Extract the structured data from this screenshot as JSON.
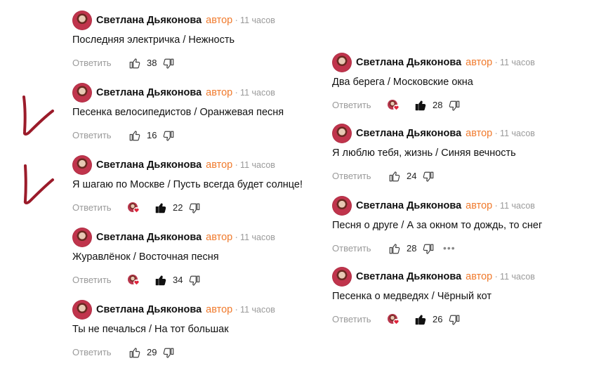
{
  "strings": {
    "author": "Светлана Дьяконова",
    "badge": "автор",
    "dot": "·",
    "time": "11 часов",
    "reply": "Ответить",
    "more": "•••"
  },
  "comments": [
    {
      "text": "Последняя электричка / Нежность",
      "likes": "38",
      "author_liked": false,
      "show_more": false
    },
    {
      "text": "Песенка велосипедистов / Оранжевая песня",
      "likes": "16",
      "author_liked": false,
      "show_more": false
    },
    {
      "text": "Я шагаю по Москве / Пусть всегда будет солнце!",
      "likes": "22",
      "author_liked": true,
      "show_more": false
    },
    {
      "text": "Журавлёнок / Восточная песня",
      "likes": "34",
      "author_liked": true,
      "show_more": false
    },
    {
      "text": "Ты не печалься / На тот большак",
      "likes": "29",
      "author_liked": false,
      "show_more": false
    },
    {
      "text": "Два берега / Московские окна",
      "likes": "28",
      "author_liked": true,
      "show_more": false
    },
    {
      "text": "Я люблю тебя, жизнь / Синяя вечность",
      "likes": "24",
      "author_liked": false,
      "show_more": false
    },
    {
      "text": "Песня о друге / А за окном то дождь, то снег",
      "likes": "28",
      "author_liked": false,
      "show_more": true
    },
    {
      "text": "Песенка о медведях / Чёрный кот",
      "likes": "26",
      "author_liked": true,
      "show_more": false
    }
  ],
  "colors": {
    "badge": "#f07a2c",
    "handwriting": "#9b1b2a"
  }
}
